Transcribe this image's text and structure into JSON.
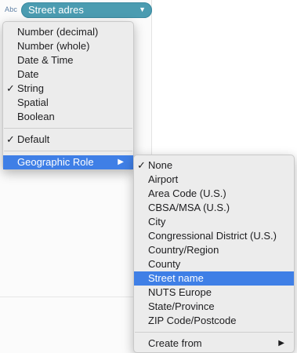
{
  "field": {
    "type_icon": "Abc",
    "name": "Street adres",
    "caret": "▼"
  },
  "main_menu": {
    "data_types": [
      {
        "label": "Number (decimal)",
        "checked": false
      },
      {
        "label": "Number (whole)",
        "checked": false
      },
      {
        "label": "Date & Time",
        "checked": false
      },
      {
        "label": "Date",
        "checked": false
      },
      {
        "label": "String",
        "checked": true
      },
      {
        "label": "Spatial",
        "checked": false
      },
      {
        "label": "Boolean",
        "checked": false
      }
    ],
    "default_label": "Default",
    "default_checked": true,
    "geo_role_label": "Geographic Role",
    "submenu_arrow": "▶"
  },
  "geo_submenu": {
    "items": [
      {
        "label": "None",
        "checked": true
      },
      {
        "label": "Airport"
      },
      {
        "label": "Area Code (U.S.)"
      },
      {
        "label": "CBSA/MSA (U.S.)"
      },
      {
        "label": "City"
      },
      {
        "label": "Congressional District (U.S.)"
      },
      {
        "label": "Country/Region"
      },
      {
        "label": "County"
      },
      {
        "label": "Street name",
        "highlighted": true
      },
      {
        "label": "NUTS Europe"
      },
      {
        "label": "State/Province"
      },
      {
        "label": "ZIP Code/Postcode"
      }
    ],
    "create_from_label": "Create from",
    "create_from_arrow": "▶"
  },
  "check_glyph": "✓",
  "colors": {
    "pill": "#4b9cb1",
    "highlight": "#3f7fe6",
    "menu_bg": "#ececec"
  }
}
